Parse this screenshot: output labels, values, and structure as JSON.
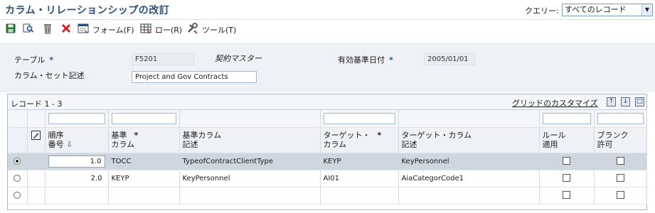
{
  "window": {
    "title": "カラム・リレーションシップの改訂",
    "query_label": "クエリー:",
    "query_value": "すべてのレコード"
  },
  "toolbar": {
    "save_icon": "save-icon",
    "find_icon": "find-icon",
    "delete_icon": "trash-icon",
    "close_icon": "close-icon",
    "form_menu": "フォーム(F)",
    "row_menu": "ロー(R)",
    "tools_menu": "ツール(T)"
  },
  "header": {
    "table_label": "テーブル",
    "table_required": "*",
    "table_value": "F5201",
    "table_description": "契約マスター",
    "effective_date_label": "有効基準日付",
    "effective_date_required": "*",
    "effective_date_value": "2005/01/01",
    "column_set_label": "カラム・セット記述",
    "column_set_value": "Project and Gov Contracts"
  },
  "grid": {
    "records_label": "レコード 1 - 3",
    "customize_label": "グリッドのカスタマイズ",
    "columns": [
      {
        "key": "seq",
        "line1": "順序",
        "line2": "番号",
        "sort": "⇩"
      },
      {
        "key": "base_col",
        "line1": "基準",
        "line2": "カラム",
        "required": "*"
      },
      {
        "key": "base_desc",
        "line1": "基準カラム",
        "line2": "記述"
      },
      {
        "key": "target_col",
        "line1": "ターゲット・",
        "line2": "カラム",
        "required": "*"
      },
      {
        "key": "target_desc",
        "line1": "ターゲット・カラム",
        "line2": "記述"
      },
      {
        "key": "rule",
        "line1": "ルール",
        "line2": "適用"
      },
      {
        "key": "blank",
        "line1": "ブランク",
        "line2": "許可"
      }
    ],
    "rows": [
      {
        "selected": true,
        "seq": "1.0",
        "base_col": "TOCC",
        "base_desc": "TypeofContractClientType",
        "target_col": "KEYP",
        "target_desc": "KeyPersonnel",
        "rule": false,
        "blank": false
      },
      {
        "selected": false,
        "seq": "2.0",
        "base_col": "KEYP",
        "base_desc": "KeyPersonnel",
        "target_col": "AI01",
        "target_desc": "AiaCategorCode1",
        "rule": false,
        "blank": false
      },
      {
        "selected": false,
        "seq": "",
        "base_col": "",
        "base_desc": "",
        "target_col": "",
        "target_desc": "",
        "rule": false,
        "blank": false
      }
    ]
  }
}
